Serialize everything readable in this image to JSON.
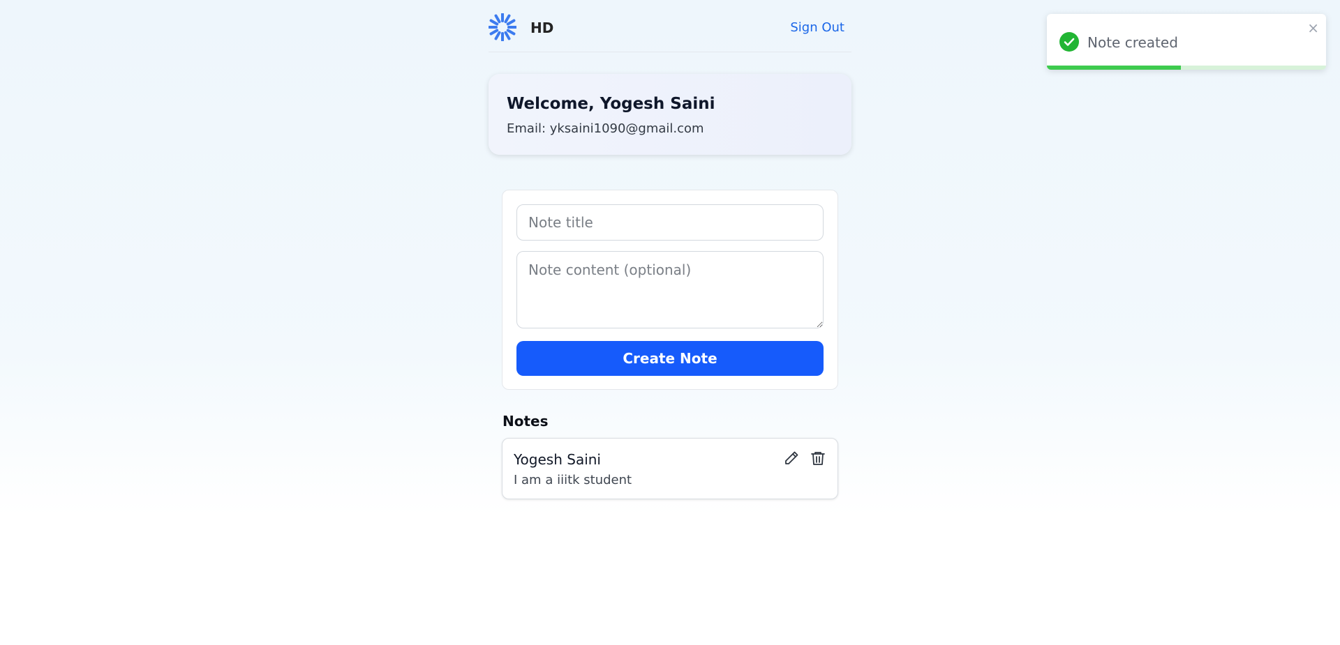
{
  "header": {
    "logo_text": "HD",
    "sign_out_label": "Sign Out"
  },
  "welcome": {
    "title": "Welcome, Yogesh Saini",
    "email_line": "Email: yksaini1090@gmail.com"
  },
  "note_form": {
    "title_placeholder": "Note title",
    "title_value": "",
    "content_placeholder": "Note content (optional)",
    "content_value": "",
    "create_label": "Create Note"
  },
  "notes": {
    "heading": "Notes",
    "items": [
      {
        "title": "Yogesh Saini",
        "content": "I am a iiitk student",
        "edit_icon": "pencil-icon",
        "delete_icon": "trash-icon"
      }
    ]
  },
  "toast": {
    "message": "Note created",
    "close_symbol": "×",
    "icon": "check-circle-icon",
    "progress_fraction": 0.48
  },
  "colors": {
    "accent": "#165bfb",
    "link": "#1a66e8",
    "success": "#22b534",
    "progress": "#3ecb4e",
    "logo": "#3c7bef"
  }
}
